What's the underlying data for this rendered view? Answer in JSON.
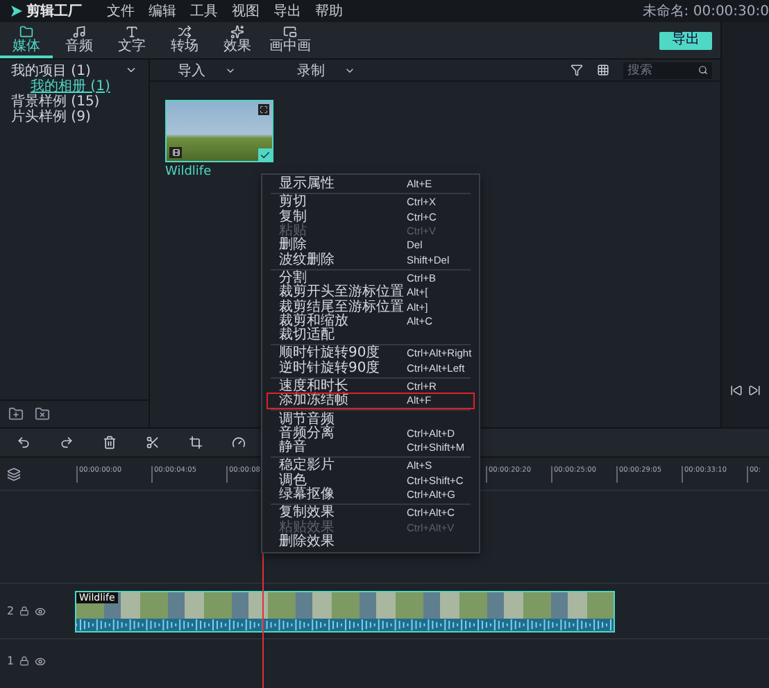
{
  "app": {
    "logo": "剪辑工厂",
    "menu": [
      "文件",
      "编辑",
      "工具",
      "视图",
      "导出",
      "帮助"
    ],
    "project_time": "未命名: 00:00:30:0"
  },
  "tabs": [
    {
      "label": "媒体",
      "selected": true
    },
    {
      "label": "音频",
      "selected": false
    },
    {
      "label": "文字",
      "selected": false
    },
    {
      "label": "转场",
      "selected": false
    },
    {
      "label": "效果",
      "selected": false
    },
    {
      "label": "画中画",
      "selected": false
    }
  ],
  "export_button": "导出",
  "library": [
    {
      "label": "我的项目 (1)",
      "expanded": true,
      "selected": false,
      "children": [
        {
          "label": "我的相册 (1)",
          "selected": true
        }
      ]
    },
    {
      "label": "背景样例 (15)",
      "selected": false
    },
    {
      "label": "片头样例 (9)",
      "selected": false
    }
  ],
  "media_toolbar": {
    "import": "导入",
    "record": "录制",
    "search": {
      "placeholder": "搜索"
    }
  },
  "media": [
    {
      "name": "Wildlife",
      "selected": true
    }
  ],
  "timeline": {
    "ruler": [
      "00:00:00:00",
      "00:00:04:05",
      "00:00:08",
      "00:00:20:20",
      "00:00:25:00",
      "00:00:29:05",
      "00:00:33:10",
      "00:"
    ],
    "tracks": [
      {
        "number": "2",
        "kind": "video",
        "clip_title": "Wildlife"
      },
      {
        "number": "1",
        "kind": "audio"
      }
    ]
  },
  "context_menu": [
    [
      {
        "label": "显示属性",
        "shortcut": "Alt+E",
        "disabled": false,
        "highlighted": false
      }
    ],
    [
      {
        "label": "剪切",
        "shortcut": "Ctrl+X",
        "disabled": false,
        "highlighted": false
      },
      {
        "label": "复制",
        "shortcut": "Ctrl+C",
        "disabled": false,
        "highlighted": false
      },
      {
        "label": "粘贴",
        "shortcut": "Ctrl+V",
        "disabled": true,
        "highlighted": false
      },
      {
        "label": "删除",
        "shortcut": "Del",
        "disabled": false,
        "highlighted": false
      },
      {
        "label": "波纹删除",
        "shortcut": "Shift+Del",
        "disabled": false,
        "highlighted": false
      }
    ],
    [
      {
        "label": "分割",
        "shortcut": "Ctrl+B",
        "disabled": false,
        "highlighted": false
      },
      {
        "label": "裁剪开头至游标位置",
        "shortcut": "Alt+[",
        "disabled": false,
        "highlighted": false
      },
      {
        "label": "裁剪结尾至游标位置",
        "shortcut": "Alt+]",
        "disabled": false,
        "highlighted": false
      },
      {
        "label": "裁剪和缩放",
        "shortcut": "Alt+C",
        "disabled": false,
        "highlighted": false
      },
      {
        "label": "裁切适配",
        "disabled": false,
        "highlighted": false
      }
    ],
    [
      {
        "label": "顺时针旋转90度",
        "shortcut": "Ctrl+Alt+Right",
        "disabled": false,
        "highlighted": false
      },
      {
        "label": "逆时针旋转90度",
        "shortcut": "Ctrl+Alt+Left",
        "disabled": false,
        "highlighted": false
      }
    ],
    [
      {
        "label": "速度和时长",
        "shortcut": "Ctrl+R",
        "disabled": false,
        "highlighted": false
      },
      {
        "label": "添加冻结帧",
        "shortcut": "Alt+F",
        "disabled": false,
        "highlighted": true
      }
    ],
    [
      {
        "label": "调节音频",
        "disabled": false,
        "highlighted": false
      },
      {
        "label": "音频分离",
        "shortcut": "Ctrl+Alt+D",
        "disabled": false,
        "highlighted": false
      },
      {
        "label": "静音",
        "shortcut": "Ctrl+Shift+M",
        "disabled": false,
        "highlighted": false
      }
    ],
    [
      {
        "label": "稳定影片",
        "shortcut": "Alt+S",
        "disabled": false,
        "highlighted": false
      },
      {
        "label": "调色",
        "shortcut": "Ctrl+Shift+C",
        "disabled": false,
        "highlighted": false
      },
      {
        "label": "绿幕抠像",
        "shortcut": "Ctrl+Alt+G",
        "disabled": false,
        "highlighted": false
      }
    ],
    [
      {
        "label": "复制效果",
        "shortcut": "Ctrl+Alt+C",
        "disabled": false,
        "highlighted": false
      },
      {
        "label": "粘贴效果",
        "shortcut": "Ctrl+Alt+V",
        "disabled": true,
        "highlighted": false
      },
      {
        "label": "删除效果",
        "disabled": false,
        "highlighted": false
      }
    ]
  ]
}
